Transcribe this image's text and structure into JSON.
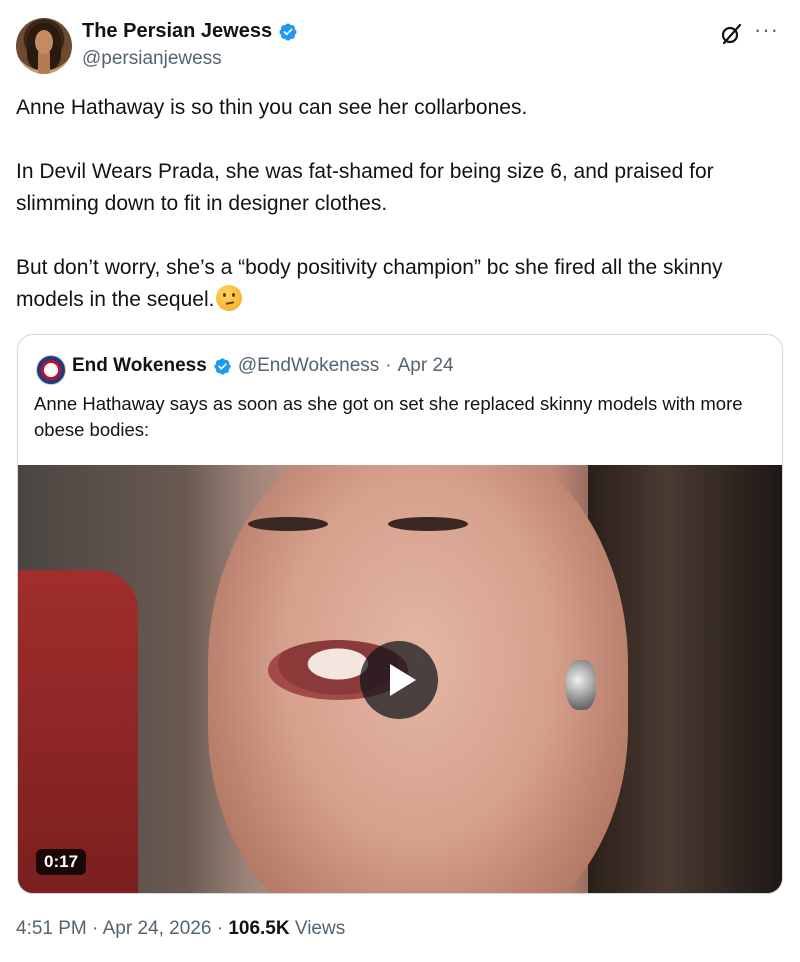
{
  "author": {
    "name": "The Persian Jewess",
    "handle": "@persianjewess",
    "verified": true
  },
  "tweet": {
    "paragraphs": [
      "Anne Hathaway is so thin you can see her collarbones.",
      "In Devil Wears Prada, she was fat-shamed for being size 6, and praised for slimming down to fit in designer clothes.",
      "But don’t worry, she’s a “body positivity champion” bc she fired all the skinny models in the sequel."
    ],
    "emoji": "thinking-face-emoji"
  },
  "quoted": {
    "name": "End Wokeness",
    "handle": "@EndWokeness",
    "separator": "·",
    "date": "Apr 24",
    "verified": true,
    "text": "Anne Hathaway says as soon as she got on set she replaced skinny models with more obese bodies:",
    "video": {
      "duration": "0:17"
    }
  },
  "footer": {
    "time": "4:51 PM",
    "sep1": "·",
    "date": "Apr 24, 2026",
    "sep2": "·",
    "views_count": "106.5K",
    "views_label": "Views"
  },
  "icons": {
    "verified_badge": "verified-badge-icon",
    "grok": "grok-icon",
    "more": "more-options-icon",
    "play": "play-icon"
  },
  "colors": {
    "text": "#0f1419",
    "secondary": "#536471",
    "verified": "#1d9bf0",
    "border": "#cfd9de"
  }
}
